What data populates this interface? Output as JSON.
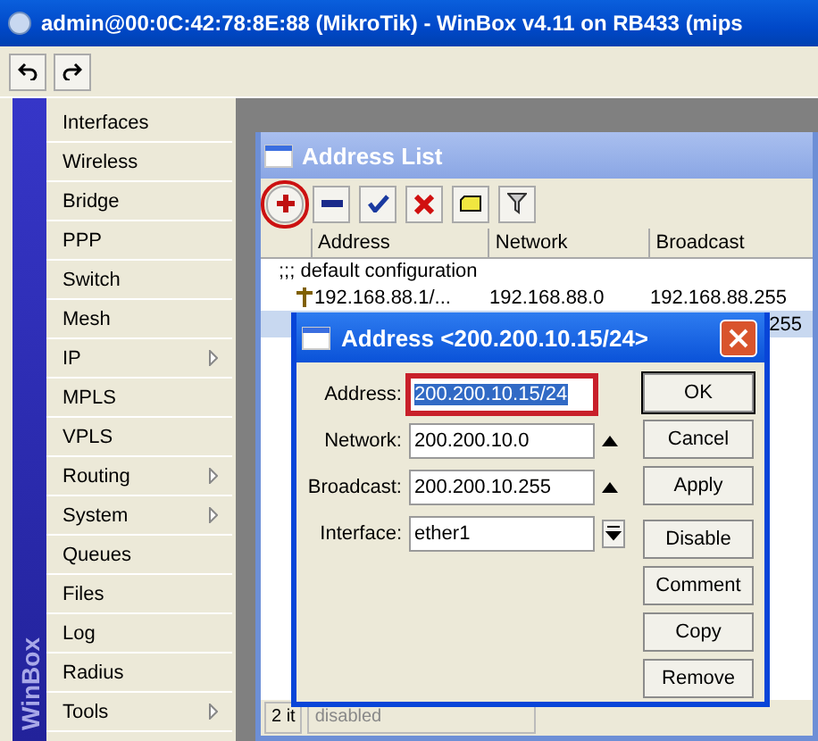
{
  "window": {
    "title": "admin@00:0C:42:78:8E:88 (MikroTik) - WinBox v4.11 on RB433 (mips"
  },
  "toolbar": [
    {
      "kind": "undo"
    },
    {
      "kind": "redo"
    }
  ],
  "sidebar": {
    "brand": "WinBox",
    "items": [
      {
        "label": "Interfaces",
        "submenu": false
      },
      {
        "label": "Wireless",
        "submenu": false
      },
      {
        "label": "Bridge",
        "submenu": false
      },
      {
        "label": "PPP",
        "submenu": false
      },
      {
        "label": "Switch",
        "submenu": false
      },
      {
        "label": "Mesh",
        "submenu": false
      },
      {
        "label": "IP",
        "submenu": true
      },
      {
        "label": "MPLS",
        "submenu": false
      },
      {
        "label": "VPLS",
        "submenu": false
      },
      {
        "label": "Routing",
        "submenu": true
      },
      {
        "label": "System",
        "submenu": true
      },
      {
        "label": "Queues",
        "submenu": false
      },
      {
        "label": "Files",
        "submenu": false
      },
      {
        "label": "Log",
        "submenu": false
      },
      {
        "label": "Radius",
        "submenu": false
      },
      {
        "label": "Tools",
        "submenu": true
      }
    ]
  },
  "address_list": {
    "title": "Address List",
    "toolbar": [
      {
        "kind": "add",
        "highlighted": true
      },
      {
        "kind": "remove",
        "highlighted": false
      },
      {
        "kind": "enable",
        "highlighted": false
      },
      {
        "kind": "disable",
        "highlighted": false
      },
      {
        "kind": "comment",
        "highlighted": false
      },
      {
        "kind": "filter",
        "highlighted": false
      }
    ],
    "columns": [
      "Address",
      "Network",
      "Broadcast"
    ],
    "comment": ";;; default configuration",
    "rows": [
      {
        "cells": [
          "192.168.88.1/...",
          "192.168.88.0",
          "192.168.88.255"
        ],
        "selected": false
      },
      {
        "cells": [
          "",
          "",
          "255"
        ],
        "selected": true
      }
    ],
    "status_bar": [
      "2 it",
      "disabled"
    ]
  },
  "dialog": {
    "title": "Address <200.200.10.15/24>",
    "fields": [
      {
        "label": "Address:",
        "value": "200.200.10.15/24",
        "kind": "text",
        "highlighted": true
      },
      {
        "label": "Network:",
        "value": "200.200.10.0",
        "kind": "up",
        "highlighted": false
      },
      {
        "label": "Broadcast:",
        "value": "200.200.10.255",
        "kind": "up",
        "highlighted": false
      },
      {
        "label": "Interface:",
        "value": "ether1",
        "kind": "dropdown",
        "highlighted": false
      }
    ],
    "buttons": [
      "OK",
      "Cancel",
      "Apply",
      "Disable",
      "Comment",
      "Copy",
      "Remove"
    ]
  }
}
